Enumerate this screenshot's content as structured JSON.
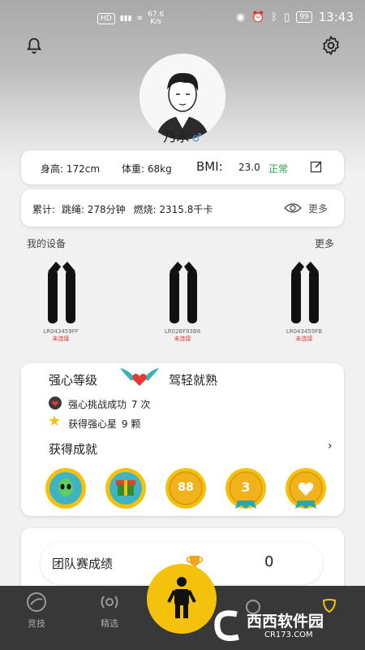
{
  "status_bar": {
    "net_label": "HD",
    "speed": "67.6",
    "speed_unit": "K/s",
    "battery": "99",
    "time": "13:43"
  },
  "profile": {
    "name": "乃水",
    "gender_symbol": "♂"
  },
  "stats": {
    "height_label": "身高:",
    "height_value": "172",
    "height_unit": "cm",
    "weight_label": "体重:",
    "weight_value": "68",
    "weight_unit": "kg",
    "bmi_label": "BMI:",
    "bmi_value": "23.0",
    "bmi_status": "正常"
  },
  "totals": {
    "label": "累计:",
    "jump_label": "跳绳:",
    "jump_value": "278分钟",
    "burn_label": "燃烧:",
    "burn_value": "2315.8千卡",
    "more": "更多"
  },
  "devices": {
    "title": "我的设备",
    "more": "更多",
    "items": [
      {
        "code": "LR043459FF",
        "status": "未连接"
      },
      {
        "code": "LR026F93B8",
        "status": "未连接"
      },
      {
        "code": "LR043459FB",
        "status": "未连接"
      }
    ]
  },
  "level": {
    "title": "强心等级",
    "rank": "驾轻就熟",
    "challenge_label": "强心挑战成功",
    "challenge_count": "7",
    "challenge_unit": "次",
    "stars_label": "获得强心星",
    "stars_count": "9",
    "stars_unit": "颗",
    "achievements_title": "获得成就",
    "badges": [
      "alien-badge",
      "gift-badge",
      "88-badge",
      "3-badge",
      "heart-badge"
    ],
    "badge_88_text": "88",
    "badge_3_text": "3"
  },
  "team": {
    "title": "团队赛成绩",
    "score": "0"
  },
  "nav": {
    "tab1": "竞技",
    "tab2": "精选"
  },
  "watermark": {
    "brand": "西西软件园",
    "url": "CR173.COM"
  },
  "colors": {
    "accent_yellow": "#f4c20d",
    "status_green": "#2e9b47",
    "status_red": "#e53935",
    "nav_bg": "#383838"
  }
}
